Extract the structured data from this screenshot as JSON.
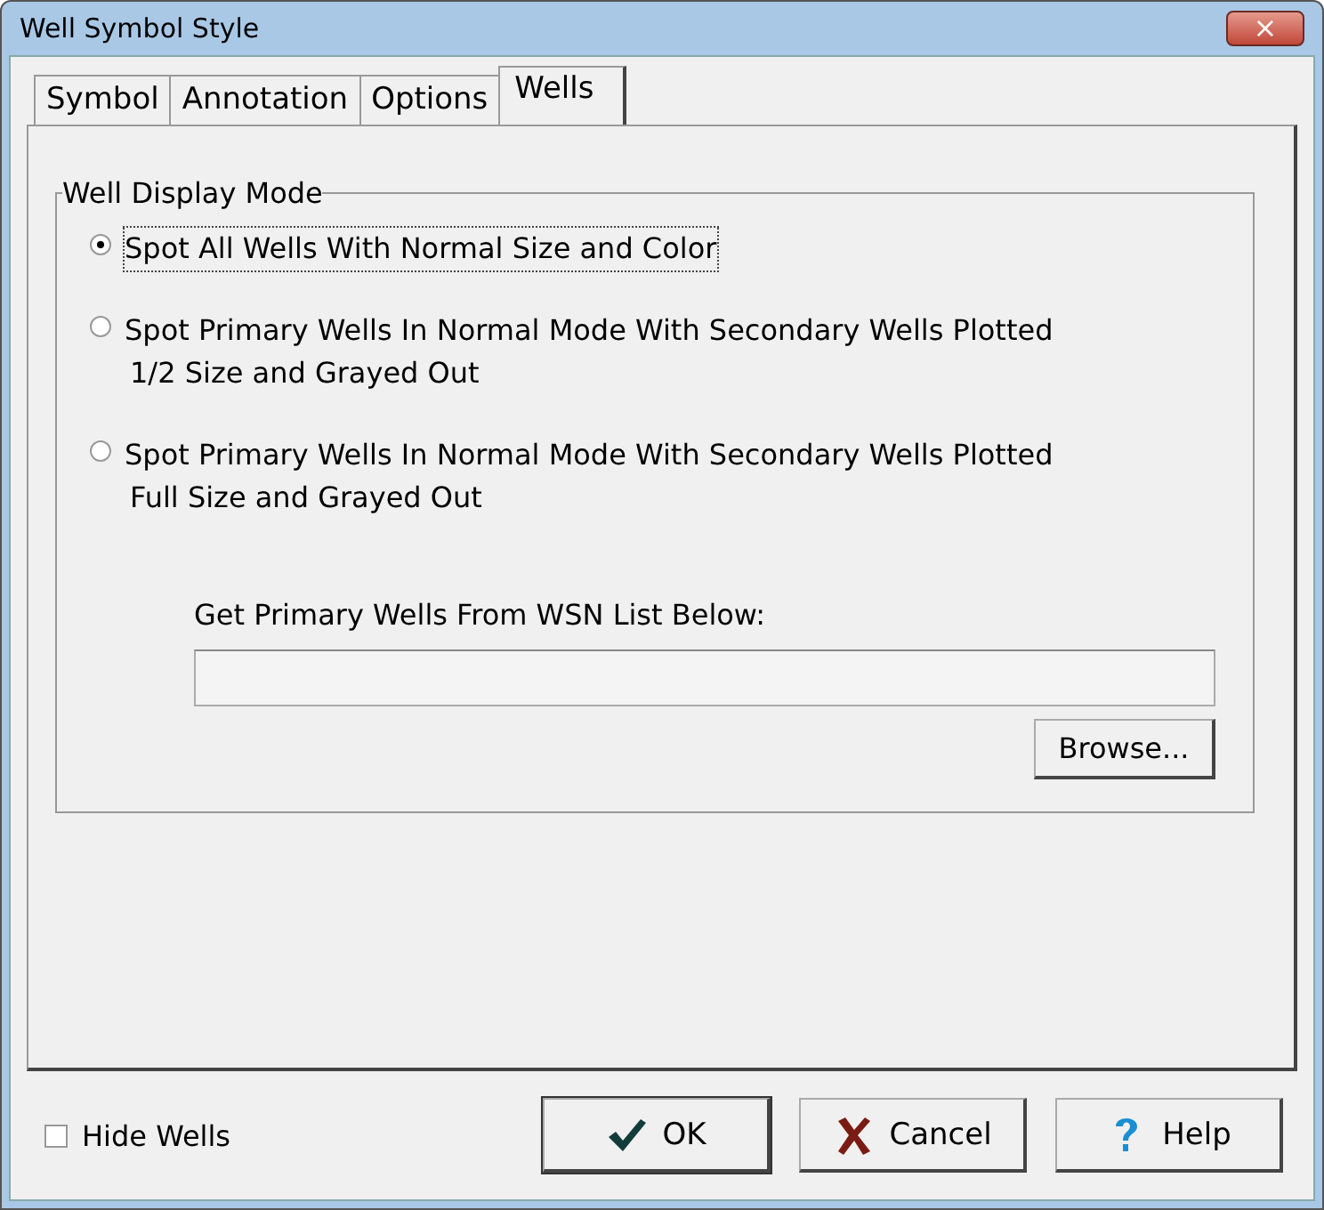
{
  "window": {
    "title": "Well Symbol Style",
    "close": "×"
  },
  "tabs": [
    {
      "label": "Symbol",
      "selected": false
    },
    {
      "label": "Annotation",
      "selected": false
    },
    {
      "label": "Options",
      "selected": false
    },
    {
      "label": "Wells",
      "selected": true
    }
  ],
  "group": {
    "title": "Well Display Mode",
    "options": [
      {
        "lines": [
          "Spot All Wells With Normal Size and Color"
        ],
        "selected": true
      },
      {
        "lines": [
          "Spot Primary Wells  In Normal Mode With Secondary Wells Plotted",
          "1/2 Size and Grayed Out"
        ],
        "selected": false
      },
      {
        "lines": [
          "Spot Primary Wells  In Normal Mode With Secondary Wells Plotted",
          "Full Size and Grayed Out"
        ],
        "selected": false
      }
    ],
    "list_label": "Get Primary Wells From WSN List Below:",
    "browse": "Browse..."
  },
  "hide_wells": {
    "label": "Hide Wells",
    "checked": false
  },
  "buttons": [
    {
      "kind": "ok",
      "label": "OK"
    },
    {
      "kind": "cancel",
      "label": "Cancel"
    },
    {
      "kind": "help",
      "label": "Help"
    }
  ]
}
